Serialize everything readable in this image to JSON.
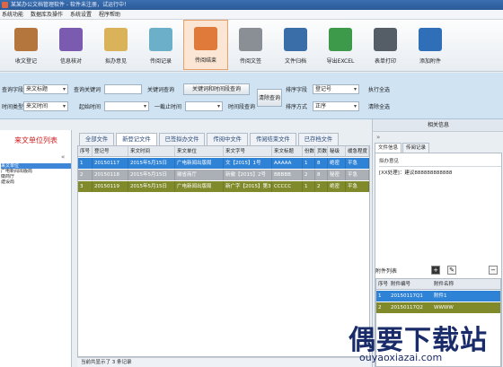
{
  "window": {
    "title": "某某办公文档管理软件 - 软件未注册，试运行中！"
  },
  "menu": [
    "系统功能",
    "数据库及操作",
    "系统设置",
    "程序帮助"
  ],
  "toolbar": [
    {
      "label": "收文登记",
      "icon": "book-register-icon",
      "color": "#b5763e",
      "active": false
    },
    {
      "label": "信息核对",
      "icon": "notebook-icon",
      "color": "#7a5bb0",
      "active": false
    },
    {
      "label": "拟办意见",
      "icon": "pen-paper-icon",
      "color": "#d9b25a",
      "active": false
    },
    {
      "label": "传阅记录",
      "icon": "circulate-icon",
      "color": "#6bb0c8",
      "active": false
    },
    {
      "label": "传阅结束",
      "icon": "finish-stamp-icon",
      "color": "#e07a3a",
      "active": true
    },
    {
      "label": "传阅文签",
      "icon": "printer-sign-icon",
      "color": "#8a8f96",
      "active": false
    },
    {
      "label": "文件归档",
      "icon": "binders-icon",
      "color": "#3a6ea8",
      "active": false
    },
    {
      "label": "导出EXCEL",
      "icon": "excel-export-icon",
      "color": "#3d9a4a",
      "active": false
    },
    {
      "label": "表单打印",
      "icon": "printer-icon",
      "color": "#555d66",
      "active": false
    },
    {
      "label": "添加附件",
      "icon": "attach-folder-icon",
      "color": "#2f6fb8",
      "active": false
    }
  ],
  "filter": {
    "query_field_label": "查询字段",
    "query_field_value": "来文标题",
    "query_keyword_label": "查询关键词",
    "keyword_query_button": "关键词查询",
    "keyword_time_query_button": "关键词和时间段查询",
    "clear_query_button": "清除查询",
    "time_type_label": "时间类型",
    "time_type_value": "来文时间",
    "start_time_label": "起始时间",
    "to_label": "一截止时间",
    "time_range_query_button": "时间段查询",
    "sort_field_label": "排序字段",
    "sort_field_value": "登记号",
    "sort_method_label": "排序方式",
    "sort_method_value": "正序",
    "execute_sort_button": "执行全选",
    "clear_sort_button": "清除全选"
  },
  "left_panel": {
    "title": "来文单位列表",
    "collapse": "«",
    "items": [
      "来文单位",
      "广电新闻出版局",
      "徽商厅",
      "建设局"
    ]
  },
  "tabs": [
    {
      "label": "全部文件",
      "active": false
    },
    {
      "label": "新登记文件",
      "active": true
    },
    {
      "label": "已签拟办文件",
      "active": false
    },
    {
      "label": "传阅中文件",
      "active": false
    },
    {
      "label": "传阅结束文件",
      "active": false
    },
    {
      "label": "已存档文件",
      "active": false
    }
  ],
  "grid": {
    "columns": [
      "序号",
      "登记号",
      "来文时间",
      "来文单位",
      "来文字号",
      "来文标题",
      "份数",
      "页数",
      "秘级",
      "缓急程度"
    ],
    "rows": [
      {
        "cells": [
          "1",
          "20150117",
          "2015年5月15日",
          "广电新闻出版局",
          "文【2015】1号",
          "AAAAA",
          "1",
          "8",
          "绝密",
          "平急"
        ]
      },
      {
        "cells": [
          "2",
          "20150118",
          "2015年5月15日",
          "徽省商厅",
          "新徽【2015】2号",
          "BBBBB",
          "2",
          "8",
          "秘密",
          "平急"
        ]
      },
      {
        "cells": [
          "3",
          "20150119",
          "2015年5月15日",
          "广电新闻出版局",
          "新广字【2015】第3号",
          "CCCCC",
          "1",
          "2",
          "绝密",
          "平急"
        ]
      }
    ]
  },
  "status": "当前共显示了 3 条记录",
  "right_panel": {
    "title": "相关信息",
    "collapse": "»",
    "tabs": [
      {
        "label": "文件信息",
        "active": true
      },
      {
        "label": "传阅记录",
        "active": false
      }
    ],
    "opinion_label": "拟办意见",
    "opinion_text": "[XX处理]：建议888888888888"
  },
  "attachments": {
    "title": "附件列表",
    "add": "+",
    "edit": "✎",
    "remove": "−",
    "columns": [
      "序号",
      "附件编号",
      "附件名称"
    ],
    "rows": [
      {
        "cells": [
          "1",
          "20150117Q1",
          "附件1"
        ]
      },
      {
        "cells": [
          "2",
          "20150117Q2",
          "WWWW"
        ]
      }
    ]
  },
  "watermark": {
    "logo": "偶要下载站",
    "url": "ouyaoxiazai.com"
  }
}
